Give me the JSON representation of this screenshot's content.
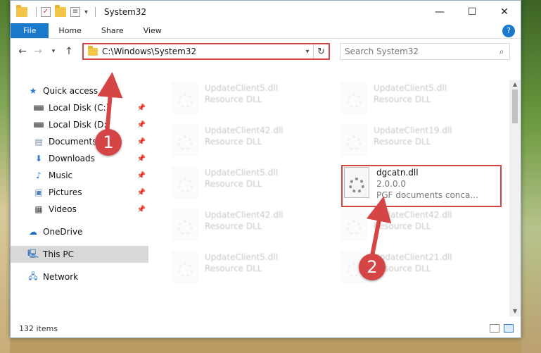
{
  "window": {
    "title": "System32",
    "controls": {
      "minimize": "—",
      "maximize": "☐",
      "close": "✕"
    }
  },
  "ribbon": {
    "tabs": [
      "File",
      "Home",
      "Share",
      "View"
    ],
    "help": "?"
  },
  "address": {
    "path": "C:\\Windows\\System32",
    "search_placeholder": "Search System32"
  },
  "nav": {
    "quick_access": "Quick access",
    "items": [
      {
        "label": "Local Disk (C:)",
        "icon": "drive-icon",
        "pinned": true
      },
      {
        "label": "Local Disk (D:)",
        "icon": "drive-icon",
        "pinned": true
      },
      {
        "label": "Documents",
        "icon": "documents-icon",
        "pinned": true
      },
      {
        "label": "Downloads",
        "icon": "downloads-icon",
        "pinned": true
      },
      {
        "label": "Music",
        "icon": "music-icon",
        "pinned": true
      },
      {
        "label": "Pictures",
        "icon": "pictures-icon",
        "pinned": true
      },
      {
        "label": "Videos",
        "icon": "videos-icon",
        "pinned": true
      }
    ],
    "onedrive": "OneDrive",
    "this_pc": "This PC",
    "network": "Network"
  },
  "files": [
    {
      "name": "UpdateClient5.dll",
      "desc": "Resource DLL"
    },
    {
      "name": "UpdateClient5.dll",
      "desc": "Resource DLL"
    },
    {
      "name": "UpdateClient42.dll",
      "desc": "Resource DLL"
    },
    {
      "name": "UpdateClient19.dll",
      "desc": "Resource DLL"
    },
    {
      "name": "UpdateClient5.dll",
      "desc": "Resource DLL"
    },
    {
      "name": "UpdateClient42.dll",
      "desc": "Resource DLL"
    },
    {
      "name": "UpdateClient42.dll",
      "desc": "Resource DLL"
    },
    {
      "name": "UpdateClient5.dll",
      "desc": "Resource DLL"
    },
    {
      "name": "UpdateClient21.dll",
      "desc": "Resource DLL"
    }
  ],
  "highlighted_file": {
    "name": "dgcatn.dll",
    "version": "2.0.0.0",
    "desc": "PGF documents conca..."
  },
  "status": {
    "item_count": "132 items"
  },
  "annotations": {
    "step1": "1",
    "step2": "2"
  },
  "colors": {
    "accent": "#1979ca",
    "highlight": "#d64545"
  }
}
